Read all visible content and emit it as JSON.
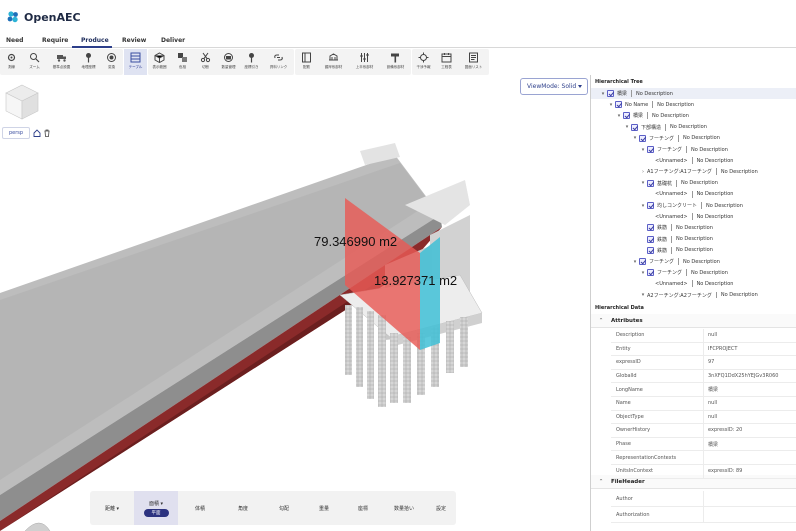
{
  "app": {
    "title": "OpenAEC"
  },
  "colors": {
    "accent": "#2c3e8a",
    "active_pill": "#2c3280",
    "area_red": "#e85a55",
    "area_cyan": "#3fc0d6"
  },
  "menu": [
    {
      "label": "Need"
    },
    {
      "label": "Require"
    },
    {
      "label": "Produce",
      "active": true
    },
    {
      "label": "Review"
    },
    {
      "label": "Deliver"
    }
  ],
  "toolbar": {
    "tools": [
      {
        "icon": "gear-icon",
        "label": "測線"
      },
      {
        "icon": "magnify-icon",
        "label": "ズーム"
      },
      {
        "icon": "truck-icon",
        "label": "基準点設置"
      },
      {
        "icon": "pin-icon",
        "label": "地理座標"
      },
      {
        "icon": "target-icon",
        "label": "変換"
      },
      {
        "icon": "table-icon",
        "label": "テーブル",
        "active": true
      },
      {
        "icon": "cube-icon",
        "label": "表示範囲"
      },
      {
        "icon": "layers-icon",
        "label": "色相"
      },
      {
        "icon": "scissors-icon",
        "label": "切断"
      },
      {
        "icon": "box-icon",
        "label": "数量管理"
      },
      {
        "icon": "pin-icon",
        "label": "座標引き"
      },
      {
        "icon": "link-icon",
        "label": "資料リンク"
      },
      {
        "icon": "panel-icon",
        "label": "配筋"
      },
      {
        "icon": "bridge-icon",
        "label": "護岸系部材"
      },
      {
        "icon": "sliders-icon",
        "label": "上半系部材"
      },
      {
        "icon": "hammer-icon",
        "label": "設備系部材"
      },
      {
        "icon": "puzzle-icon",
        "label": "干渉予報"
      },
      {
        "icon": "calendar-icon",
        "label": "工程表"
      },
      {
        "icon": "list-icon",
        "label": "図面リスト"
      }
    ]
  },
  "viewport": {
    "persp_label": "persp",
    "viewmode_label": "ViewMode: Solid",
    "measurements": [
      "79.346990 m2",
      "13.927371 m2"
    ]
  },
  "measure_bar": {
    "tools": [
      {
        "label": "距離 ▾"
      },
      {
        "label": "面積 ▾",
        "active": true,
        "sub": "平面"
      },
      {
        "label": "体積"
      },
      {
        "label": "角度"
      },
      {
        "label": "勾配"
      },
      {
        "label": "重量"
      },
      {
        "label": "座標"
      },
      {
        "label": "数量拾い"
      },
      {
        "label": "設定"
      }
    ]
  },
  "tree": {
    "title": "Hierarchical Tree",
    "rows": [
      {
        "depth": 0,
        "chev": "▾",
        "name": "橋梁",
        "desc": "No Description",
        "selected": true
      },
      {
        "depth": 1,
        "chev": "▾",
        "name": "No Name",
        "desc": "No Description"
      },
      {
        "depth": 2,
        "chev": "▾",
        "name": "橋梁",
        "desc": "No Description"
      },
      {
        "depth": 3,
        "chev": "▾",
        "name": "下部構造",
        "desc": "No Description"
      },
      {
        "depth": 4,
        "chev": "▾",
        "name": "フーチング",
        "desc": "No Description"
      },
      {
        "depth": 5,
        "chev": "▾",
        "name": "フーチング",
        "desc": "No Description"
      },
      {
        "depth": 6,
        "chev": "",
        "name": "<Unnamed>",
        "desc": "No Description",
        "nocb": true
      },
      {
        "depth": 5,
        "chev": "›",
        "name": "A1フーチング:A1フーチング",
        "desc": "No Description",
        "nocb": true
      },
      {
        "depth": 5,
        "chev": "▾",
        "name": "基礎杭",
        "desc": "No Description"
      },
      {
        "depth": 6,
        "chev": "",
        "name": "<Unnamed>",
        "desc": "No Description",
        "nocb": true
      },
      {
        "depth": 5,
        "chev": "▾",
        "name": "均しコンクリート",
        "desc": "No Description"
      },
      {
        "depth": 6,
        "chev": "",
        "name": "<Unnamed>",
        "desc": "No Description",
        "nocb": true
      },
      {
        "depth": 5,
        "chev": "",
        "name": "鉄筋",
        "desc": "No Description"
      },
      {
        "depth": 5,
        "chev": "",
        "name": "鉄筋",
        "desc": "No Description"
      },
      {
        "depth": 5,
        "chev": "",
        "name": "鉄筋",
        "desc": "No Description"
      },
      {
        "depth": 4,
        "chev": "▾",
        "name": "フーチング",
        "desc": "No Description"
      },
      {
        "depth": 5,
        "chev": "▾",
        "name": "フーチング",
        "desc": "No Description"
      },
      {
        "depth": 6,
        "chev": "",
        "name": "<Unnamed>",
        "desc": "No Description",
        "nocb": true
      },
      {
        "depth": 5,
        "chev": "▾",
        "name": "A2フーチング:A2フーチング",
        "desc": "No Description",
        "nocb": true
      }
    ]
  },
  "data_panel": {
    "title": "Hierarchical Data",
    "attributes_label": "Attributes",
    "attributes": [
      {
        "key": "Description",
        "value": "null"
      },
      {
        "key": "Entity",
        "value": "IFCPROJECT"
      },
      {
        "key": "expressID",
        "value": "97"
      },
      {
        "key": "GlobalId",
        "value": "3nXFQ1DdX25hYEJGv3R060"
      },
      {
        "key": "LongName",
        "value": "橋梁"
      },
      {
        "key": "Name",
        "value": "null"
      },
      {
        "key": "ObjectType",
        "value": "null"
      },
      {
        "key": "OwnerHistory",
        "value": "expressID: 20"
      },
      {
        "key": "Phase",
        "value": "橋梁"
      },
      {
        "key": "RepresentationContexts",
        "value": ""
      },
      {
        "key": "UnitsInContext",
        "value": "expressID: 89"
      }
    ],
    "fileheader_label": "FileHeader",
    "fileheader": [
      {
        "key": "Author",
        "value": ""
      },
      {
        "key": "Authorization",
        "value": ""
      }
    ]
  }
}
